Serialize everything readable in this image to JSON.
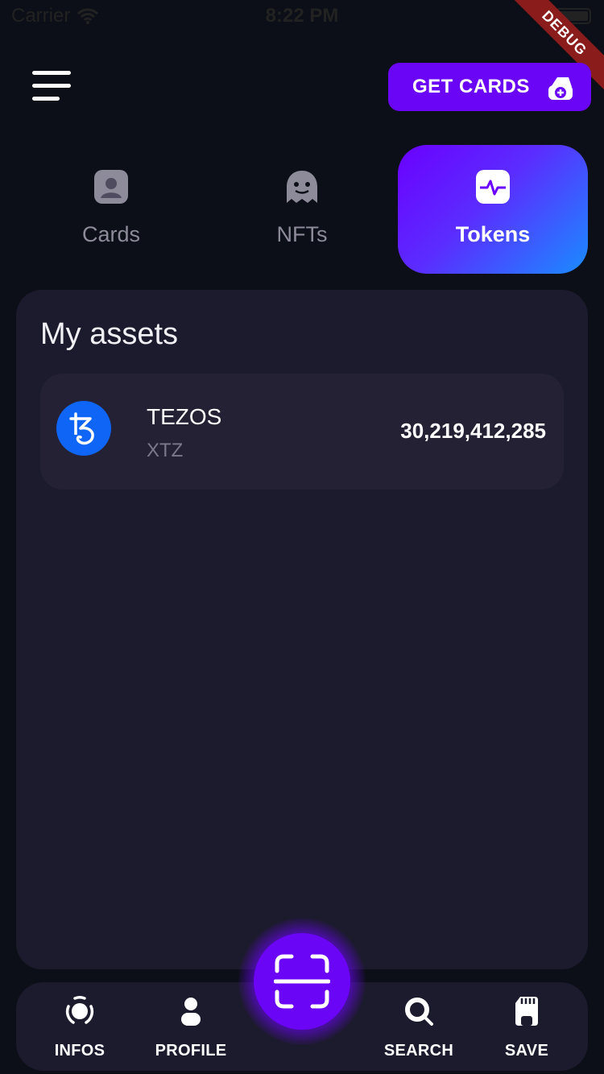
{
  "status_bar": {
    "carrier": "Carrier",
    "time": "8:22 PM"
  },
  "debug_ribbon": "DEBUG",
  "header": {
    "get_cards_label": "GET CARDS"
  },
  "tabs": [
    {
      "label": "Cards",
      "icon": "id-card-icon",
      "active": false
    },
    {
      "label": "NFTs",
      "icon": "ghost-icon",
      "active": false
    },
    {
      "label": "Tokens",
      "icon": "activity-icon",
      "active": true
    }
  ],
  "assets": {
    "title": "My assets",
    "items": [
      {
        "name": "TEZOS",
        "symbol": "XTZ",
        "amount": "30,219,412,285",
        "logo": "tezos-icon"
      }
    ]
  },
  "bottom_nav": [
    {
      "label": "INFOS",
      "icon": "radar-icon"
    },
    {
      "label": "PROFILE",
      "icon": "user-icon"
    },
    {
      "label": "SEARCH",
      "icon": "search-icon"
    },
    {
      "label": "SAVE",
      "icon": "sd-card-icon"
    }
  ],
  "colors": {
    "accent": "#6a05f5",
    "background": "#0c0f17",
    "panel": "#1c1a2d",
    "row": "#232133",
    "tezos": "#0f65f5"
  }
}
